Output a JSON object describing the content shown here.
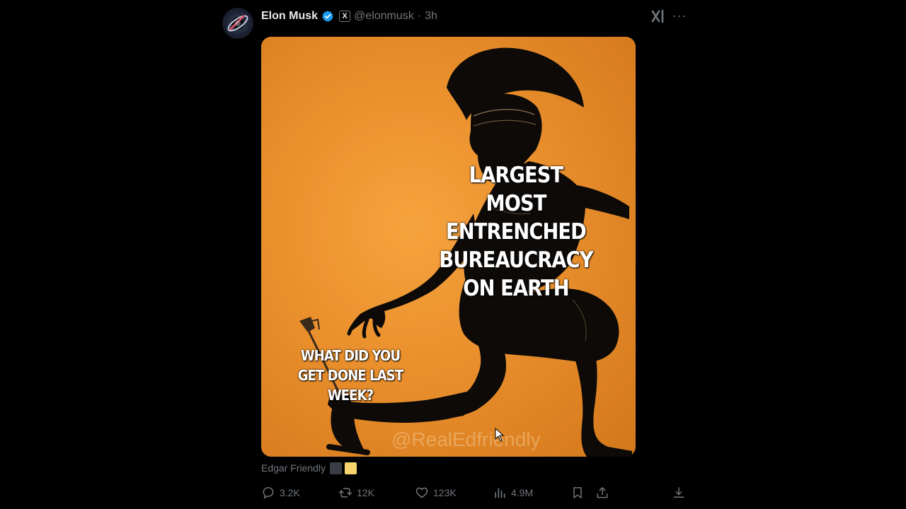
{
  "author": {
    "display_name": "Elon Musk",
    "handle": "@elonmusk",
    "separator": "·",
    "time": "3h",
    "verified_icon": "verified-badge-icon",
    "affiliation_icon": "x-logo-icon",
    "affiliation_label": "X"
  },
  "header_actions": {
    "grok_icon": "grok-icon",
    "more_icon": "more-icon",
    "more_glyph": "···"
  },
  "media": {
    "main_caption": "LARGEST\nMOST ENTRENCHED\nBUREAUCRACY\nON EARTH",
    "small_caption": "WHAT DID YOU\nGET DONE LAST WEEK?",
    "watermark": "@RealEdfriendly"
  },
  "image_credit": {
    "name": "Edgar Friendly"
  },
  "actions": {
    "replies": "3.2K",
    "reposts": "12K",
    "likes": "123K",
    "views": "4.9M",
    "reply_icon": "reply-icon",
    "repost_icon": "repost-icon",
    "like_icon": "heart-icon",
    "views_icon": "views-icon",
    "bookmark_icon": "bookmark-icon",
    "share_icon": "share-icon",
    "download_icon": "download-icon"
  },
  "colors": {
    "background": "#000000",
    "primary_text": "#e7e9ea",
    "secondary_text": "#71767b",
    "verified_blue": "#1d9bf0",
    "image_orange": "#e98f2c"
  }
}
